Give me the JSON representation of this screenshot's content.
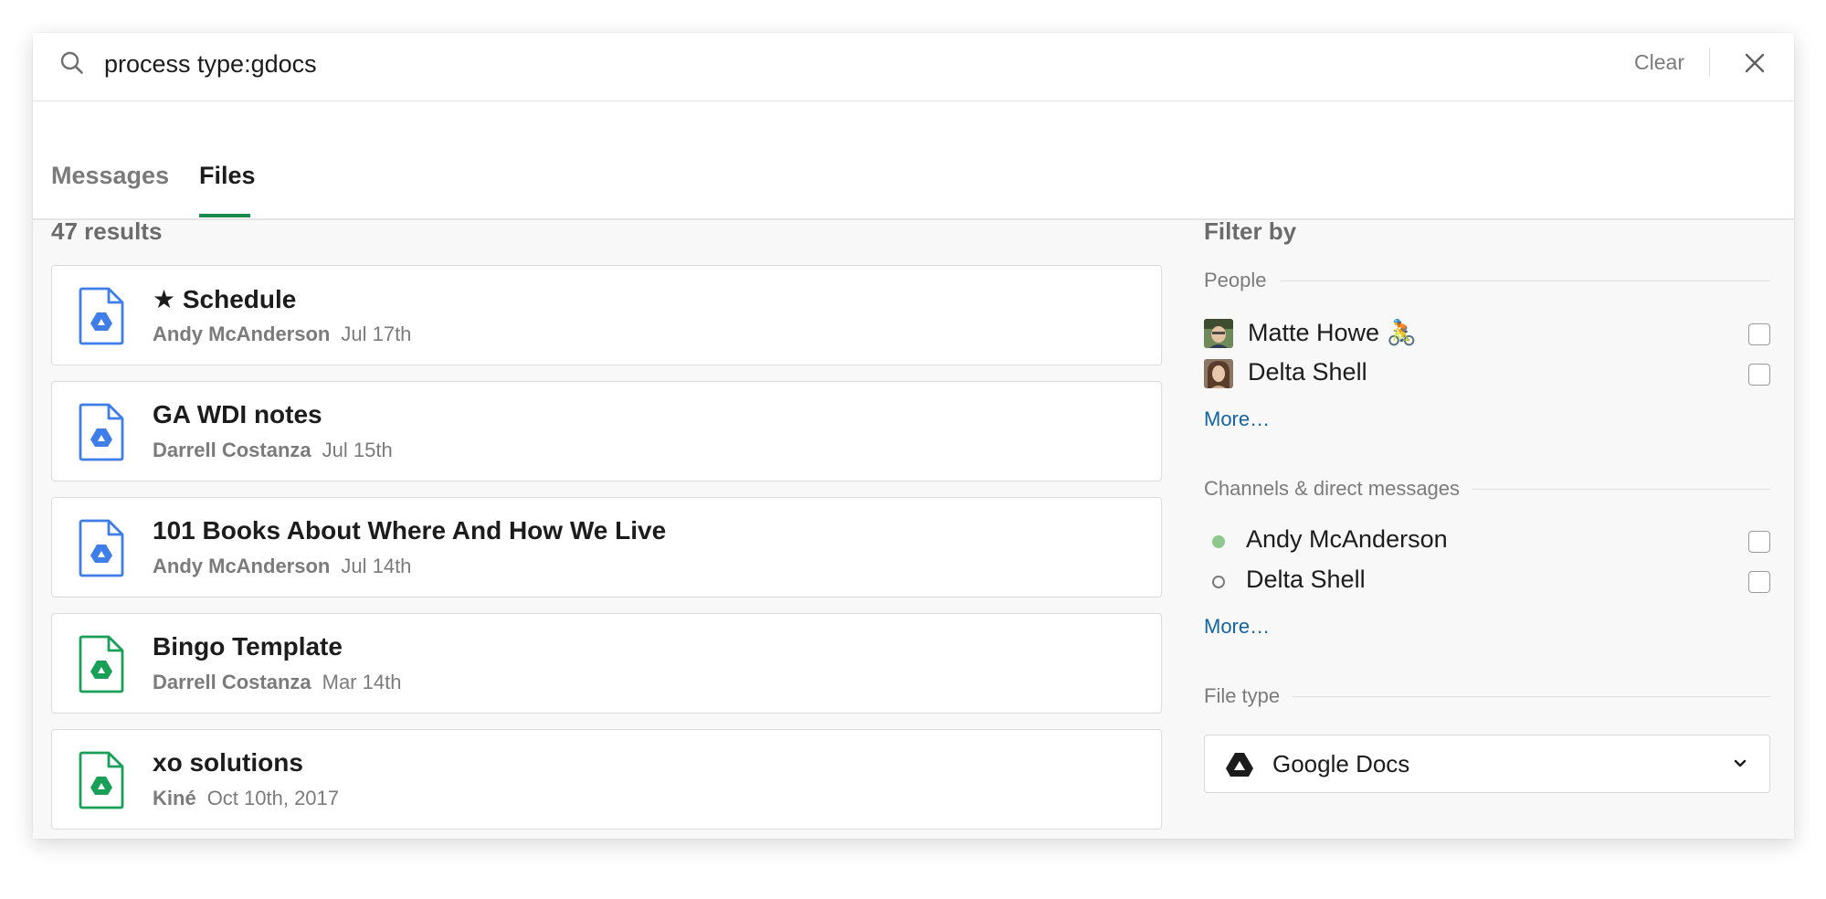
{
  "search": {
    "query": "process type:gdocs",
    "clear_label": "Clear"
  },
  "tabs": [
    {
      "label": "Messages",
      "active": false
    },
    {
      "label": "Files",
      "active": true
    }
  ],
  "results": {
    "count_label": "47 results",
    "items": [
      {
        "title": "★ Schedule",
        "author": "Andy McAnderson",
        "date": "Jul 17th",
        "icon": "google-drive-file-icon",
        "color": "#3f7ee8"
      },
      {
        "title": "GA WDI notes",
        "author": "Darrell Costanza",
        "date": "Jul 15th",
        "icon": "google-drive-file-icon",
        "color": "#3f7ee8"
      },
      {
        "title": "101 Books About Where And How We Live",
        "author": "Andy McAnderson",
        "date": "Jul 14th",
        "icon": "google-drive-file-icon",
        "color": "#3f7ee8"
      },
      {
        "title": "Bingo Template",
        "author": "Darrell Costanza",
        "date": "Mar 14th",
        "icon": "google-drive-file-icon",
        "color": "#18a058"
      },
      {
        "title": "xo solutions",
        "author": "Kiné",
        "date": "Oct 10th, 2017",
        "icon": "google-drive-file-icon",
        "color": "#18a058"
      }
    ]
  },
  "filter": {
    "title": "Filter by",
    "people": {
      "label": "People",
      "items": [
        {
          "name": "Matte Howe 🚴",
          "avatar": "avatar-matte-howe"
        },
        {
          "name": "Delta Shell",
          "avatar": "avatar-delta-shell"
        }
      ],
      "more_label": "More…"
    },
    "channels": {
      "label": "Channels & direct messages",
      "items": [
        {
          "name": "Andy McAnderson",
          "presence": "active"
        },
        {
          "name": "Delta Shell",
          "presence": "away"
        }
      ],
      "more_label": "More…"
    },
    "file_type": {
      "label": "File type",
      "selected": "Google Docs"
    }
  },
  "colors": {
    "accent_green": "#1a8a4e",
    "link_blue": "#1264a3",
    "presence_green": "#8ec88e"
  }
}
